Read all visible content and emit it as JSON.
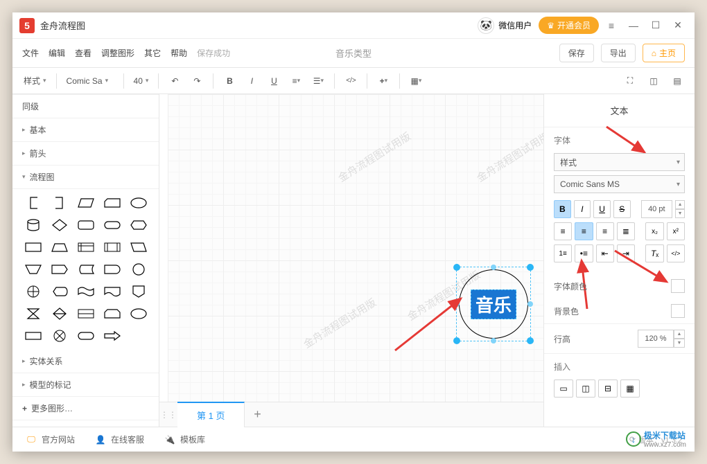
{
  "app": {
    "title": "金舟流程图"
  },
  "titlebar": {
    "user_name": "微信用户",
    "vip_label": "开通会员"
  },
  "menubar": {
    "items": [
      "文件",
      "编辑",
      "查看",
      "调整图形",
      "其它",
      "帮助"
    ],
    "save_status": "保存成功",
    "doc_title": "音乐类型",
    "save_btn": "保存",
    "export_btn": "导出",
    "home_btn": "主页"
  },
  "toolbar": {
    "style_label": "样式",
    "font": "Comic Sa",
    "size": "40"
  },
  "hierarchy": {
    "h0": "同级",
    "categories": {
      "basic": "基本",
      "arrows": "箭头",
      "flowchart": "流程图",
      "entity": "实体关系",
      "model": "模型的标记",
      "more": "更多图形…"
    }
  },
  "watermark": "金舟流程图试用版",
  "canvas": {
    "page_tab": "第 1 页",
    "shape_label": "音乐"
  },
  "text_panel": {
    "title": "文本",
    "font_label": "字体",
    "style_select": "样式",
    "font_select": "Comic Sans MS",
    "size_value": "40 pt",
    "font_color_label": "字体颜色",
    "font_color": "#f48fb1",
    "bg_color_label": "背景色",
    "bg_color": "#ffffff",
    "line_height_label": "行高",
    "line_height_value": "120 %",
    "insert_label": "插入"
  },
  "status": {
    "official": "官方网站",
    "service": "在线客服",
    "templates": "模板库",
    "version": "版本：v1.3.2",
    "download_site": "极米下载站",
    "download_url": "www.xz7.com"
  }
}
